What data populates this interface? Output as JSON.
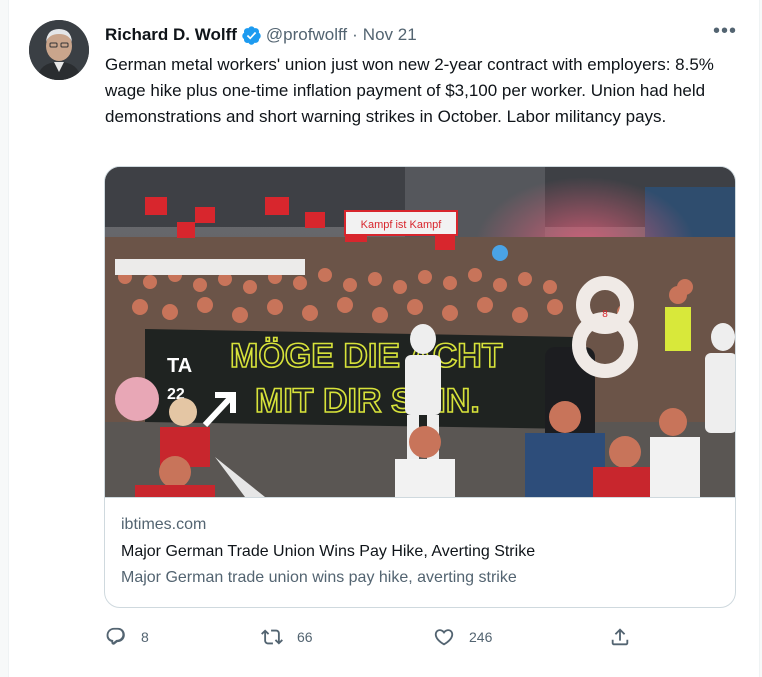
{
  "tweet": {
    "author_name": "Richard D. Wolff",
    "handle": "@profwolff",
    "separator": "·",
    "date": "Nov 21",
    "more_label": "•••",
    "text": "German metal workers' union just won new 2-year contract with employers: 8.5% wage hike plus one-time inflation payment of $3,100 per worker. Union had held demonstrations and short warning strikes in October. Labor militancy pays.",
    "avatar_icon": "profile-photo",
    "verified_icon": "verified-badge-icon",
    "accent_color": "#1d9bf0"
  },
  "card": {
    "domain": "ibtimes.com",
    "title": "Major German Trade Union Wins Pay Hike, Averting Strike",
    "description": "Major German trade union wins pay hike, averting strike",
    "image": {
      "banner_line1": "MÖGE DIE ACHT",
      "banner_line2": "MIT DIR SEIN.",
      "banner_badge": "TA",
      "banner_badge_num": "22",
      "balloon_number": "8",
      "small_banner": "Kampf ist Kampf"
    }
  },
  "actions": {
    "reply_count": "8",
    "retweet_count": "66",
    "like_count": "246",
    "reply_icon": "reply-icon",
    "retweet_icon": "retweet-icon",
    "like_icon": "heart-icon",
    "share_icon": "share-icon"
  }
}
